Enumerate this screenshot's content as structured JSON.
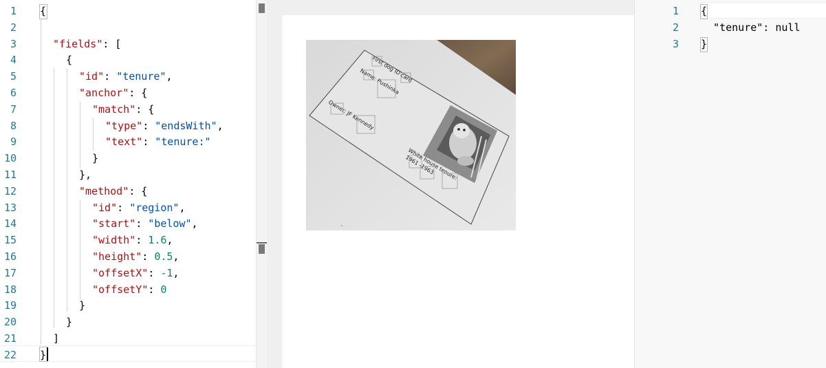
{
  "left_editor": {
    "line_numbers": [
      "1",
      "2",
      "3",
      "4",
      "5",
      "6",
      "7",
      "8",
      "9",
      "10",
      "11",
      "12",
      "13",
      "14",
      "15",
      "16",
      "17",
      "18",
      "19",
      "20",
      "21",
      "22"
    ],
    "lines": [
      [
        {
          "t": "{",
          "c": "punct"
        }
      ],
      [],
      [
        {
          "t": "\"fields\"",
          "c": "key"
        },
        {
          "t": ": [",
          "c": "punct"
        }
      ],
      [
        {
          "t": "{",
          "c": "punct"
        }
      ],
      [
        {
          "t": "\"id\"",
          "c": "key"
        },
        {
          "t": ": ",
          "c": "punct"
        },
        {
          "t": "\"tenure\"",
          "c": "str"
        },
        {
          "t": ",",
          "c": "punct"
        }
      ],
      [
        {
          "t": "\"anchor\"",
          "c": "key"
        },
        {
          "t": ": {",
          "c": "punct"
        }
      ],
      [
        {
          "t": "\"match\"",
          "c": "key"
        },
        {
          "t": ": {",
          "c": "punct"
        }
      ],
      [
        {
          "t": "\"type\"",
          "c": "key"
        },
        {
          "t": ": ",
          "c": "punct"
        },
        {
          "t": "\"endsWith\"",
          "c": "str"
        },
        {
          "t": ",",
          "c": "punct"
        }
      ],
      [
        {
          "t": "\"text\"",
          "c": "key"
        },
        {
          "t": ": ",
          "c": "punct"
        },
        {
          "t": "\"tenure:\"",
          "c": "str"
        }
      ],
      [
        {
          "t": "}",
          "c": "punct"
        }
      ],
      [
        {
          "t": "},",
          "c": "punct"
        }
      ],
      [
        {
          "t": "\"method\"",
          "c": "key"
        },
        {
          "t": ": {",
          "c": "punct"
        }
      ],
      [
        {
          "t": "\"id\"",
          "c": "key"
        },
        {
          "t": ": ",
          "c": "punct"
        },
        {
          "t": "\"region\"",
          "c": "str"
        },
        {
          "t": ",",
          "c": "punct"
        }
      ],
      [
        {
          "t": "\"start\"",
          "c": "key"
        },
        {
          "t": ": ",
          "c": "punct"
        },
        {
          "t": "\"below\"",
          "c": "str"
        },
        {
          "t": ",",
          "c": "punct"
        }
      ],
      [
        {
          "t": "\"width\"",
          "c": "key"
        },
        {
          "t": ": ",
          "c": "punct"
        },
        {
          "t": "1.6",
          "c": "num"
        },
        {
          "t": ",",
          "c": "punct"
        }
      ],
      [
        {
          "t": "\"height\"",
          "c": "key"
        },
        {
          "t": ": ",
          "c": "punct"
        },
        {
          "t": "0.5",
          "c": "num"
        },
        {
          "t": ",",
          "c": "punct"
        }
      ],
      [
        {
          "t": "\"offsetX\"",
          "c": "key"
        },
        {
          "t": ": ",
          "c": "punct"
        },
        {
          "t": "-1",
          "c": "num"
        },
        {
          "t": ",",
          "c": "punct"
        }
      ],
      [
        {
          "t": "\"offsetY\"",
          "c": "key"
        },
        {
          "t": ": ",
          "c": "punct"
        },
        {
          "t": "0",
          "c": "num"
        }
      ],
      [
        {
          "t": "}",
          "c": "punct"
        }
      ],
      [
        {
          "t": "}",
          "c": "punct"
        }
      ],
      [
        {
          "t": "]",
          "c": "punct"
        }
      ],
      [
        {
          "t": "}",
          "c": "punct"
        }
      ]
    ]
  },
  "preview": {
    "card_texts": {
      "title": "First dog ID card",
      "name": "Name: Pushinka",
      "owner": "Owner: JF Kennedy",
      "tenure_label": "White house tenure:",
      "tenure_value": "1961 -1963"
    }
  },
  "right_editor": {
    "line_numbers": [
      "1",
      "2",
      "3"
    ],
    "lines": [
      "{",
      "  \"tenure\": null",
      "}"
    ]
  },
  "colors": {
    "key": "#a31515",
    "string": "#0451a5",
    "number": "#098658",
    "line_number": "#237893"
  }
}
